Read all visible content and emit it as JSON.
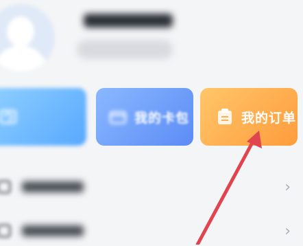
{
  "cards": [
    {
      "label": "",
      "icon": "refresh-icon",
      "color": "#57a8ff"
    },
    {
      "label": "我的卡包",
      "icon": "wallet-icon",
      "color": "#5b8cf5"
    },
    {
      "label": "我的订单",
      "icon": "order-icon",
      "color": "#ff9c3c"
    }
  ],
  "list": [
    {
      "label": "",
      "icon": "list-icon"
    },
    {
      "label": "",
      "icon": "list-icon"
    }
  ],
  "annotation": {
    "arrow_color": "#e0454f"
  }
}
